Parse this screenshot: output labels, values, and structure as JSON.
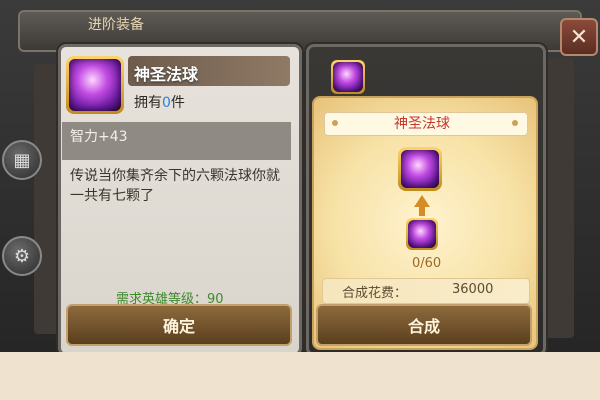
{
  "header": {
    "tab_title": "进阶装备"
  },
  "icons": {
    "close": "close-icon",
    "grid": "grid-icon",
    "gear": "gear-icon"
  },
  "item": {
    "name": "神圣法球",
    "owned_label": "拥有",
    "owned_count": "0",
    "owned_unit": "件",
    "stat": "智力+43",
    "description": "传说当你集齐余下的六颗法球你就一共有七颗了",
    "requirement": "需求英雄等级：90",
    "confirm_label": "确定"
  },
  "synthesis": {
    "title": "神圣法球",
    "progress": "0/60",
    "cost_label": "合成花费：",
    "cost_value": "36000",
    "compose_label": "合成"
  },
  "colors": {
    "accent_red": "#c6372c",
    "requirement_green": "#3d8a2b",
    "owned_blue": "#2d7fd9"
  }
}
